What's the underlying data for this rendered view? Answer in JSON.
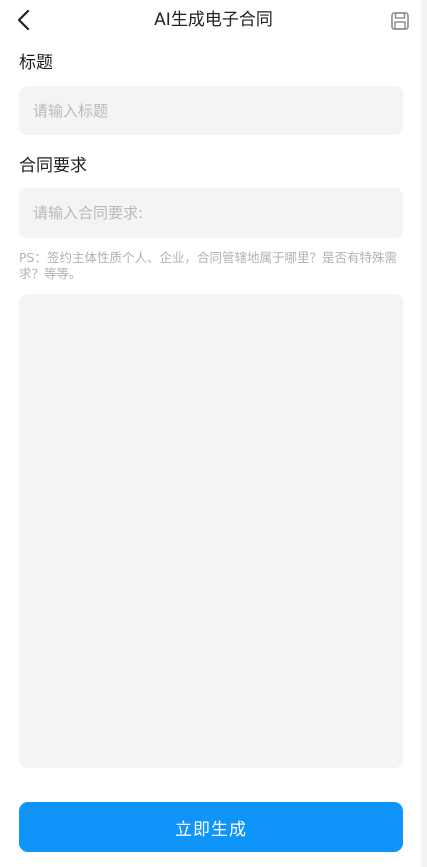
{
  "header": {
    "title": "AI生成电子合同",
    "back_icon": "chevron-left-icon",
    "save_icon": "floppy-disk-icon"
  },
  "form": {
    "title_label": "标题",
    "title_placeholder": "请输入标题",
    "requirements_label": "合同要求",
    "requirements_placeholder": "请输入合同要求:",
    "hint": "PS：签约主体性质个人、企业，合同管辖地属于哪里？是否有特殊需求？等等。",
    "details_value": ""
  },
  "actions": {
    "generate_label": "立即生成"
  },
  "colors": {
    "accent": "#0f94f9",
    "field_bg": "#f4f4f5",
    "placeholder": "#b9b9bd"
  }
}
